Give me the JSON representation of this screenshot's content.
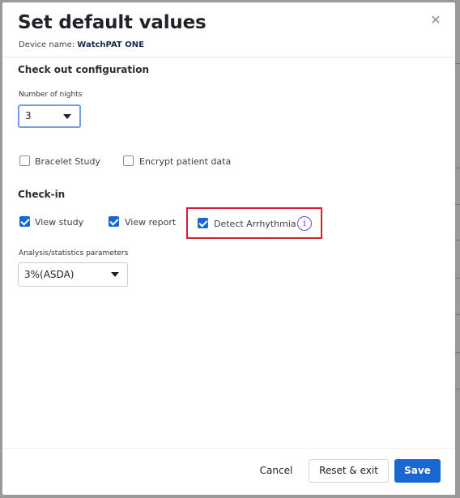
{
  "dialog": {
    "title": "Set default values",
    "close_glyph": "✕",
    "device_label": "Device name:",
    "device_name": "WatchPAT ONE"
  },
  "checkout": {
    "section_title": "Check out configuration",
    "nights_label": "Number of nights",
    "nights_value": "3",
    "options": [
      {
        "label": "Bracelet Study",
        "checked": false
      },
      {
        "label": "Encrypt patient data",
        "checked": false
      }
    ]
  },
  "checkin": {
    "section_title": "Check-in",
    "options": [
      {
        "label": "View study",
        "checked": true
      },
      {
        "label": "View report",
        "checked": true
      },
      {
        "label": "Detect Arrhythmia",
        "checked": true,
        "highlighted": true
      }
    ],
    "info_glyph": "i"
  },
  "analysis": {
    "label": "Analysis/statistics parameters",
    "value": "3%(ASDA)"
  },
  "footer": {
    "cancel_label": "Cancel",
    "reset_label": "Reset & exit",
    "save_label": "Save"
  },
  "colors": {
    "primary": "#1967d2",
    "highlight_border": "#d62029",
    "info_icon": "#6b4bd8"
  },
  "icons": [
    "close-icon",
    "chevron-down-icon",
    "checkmark-icon",
    "info-icon"
  ]
}
